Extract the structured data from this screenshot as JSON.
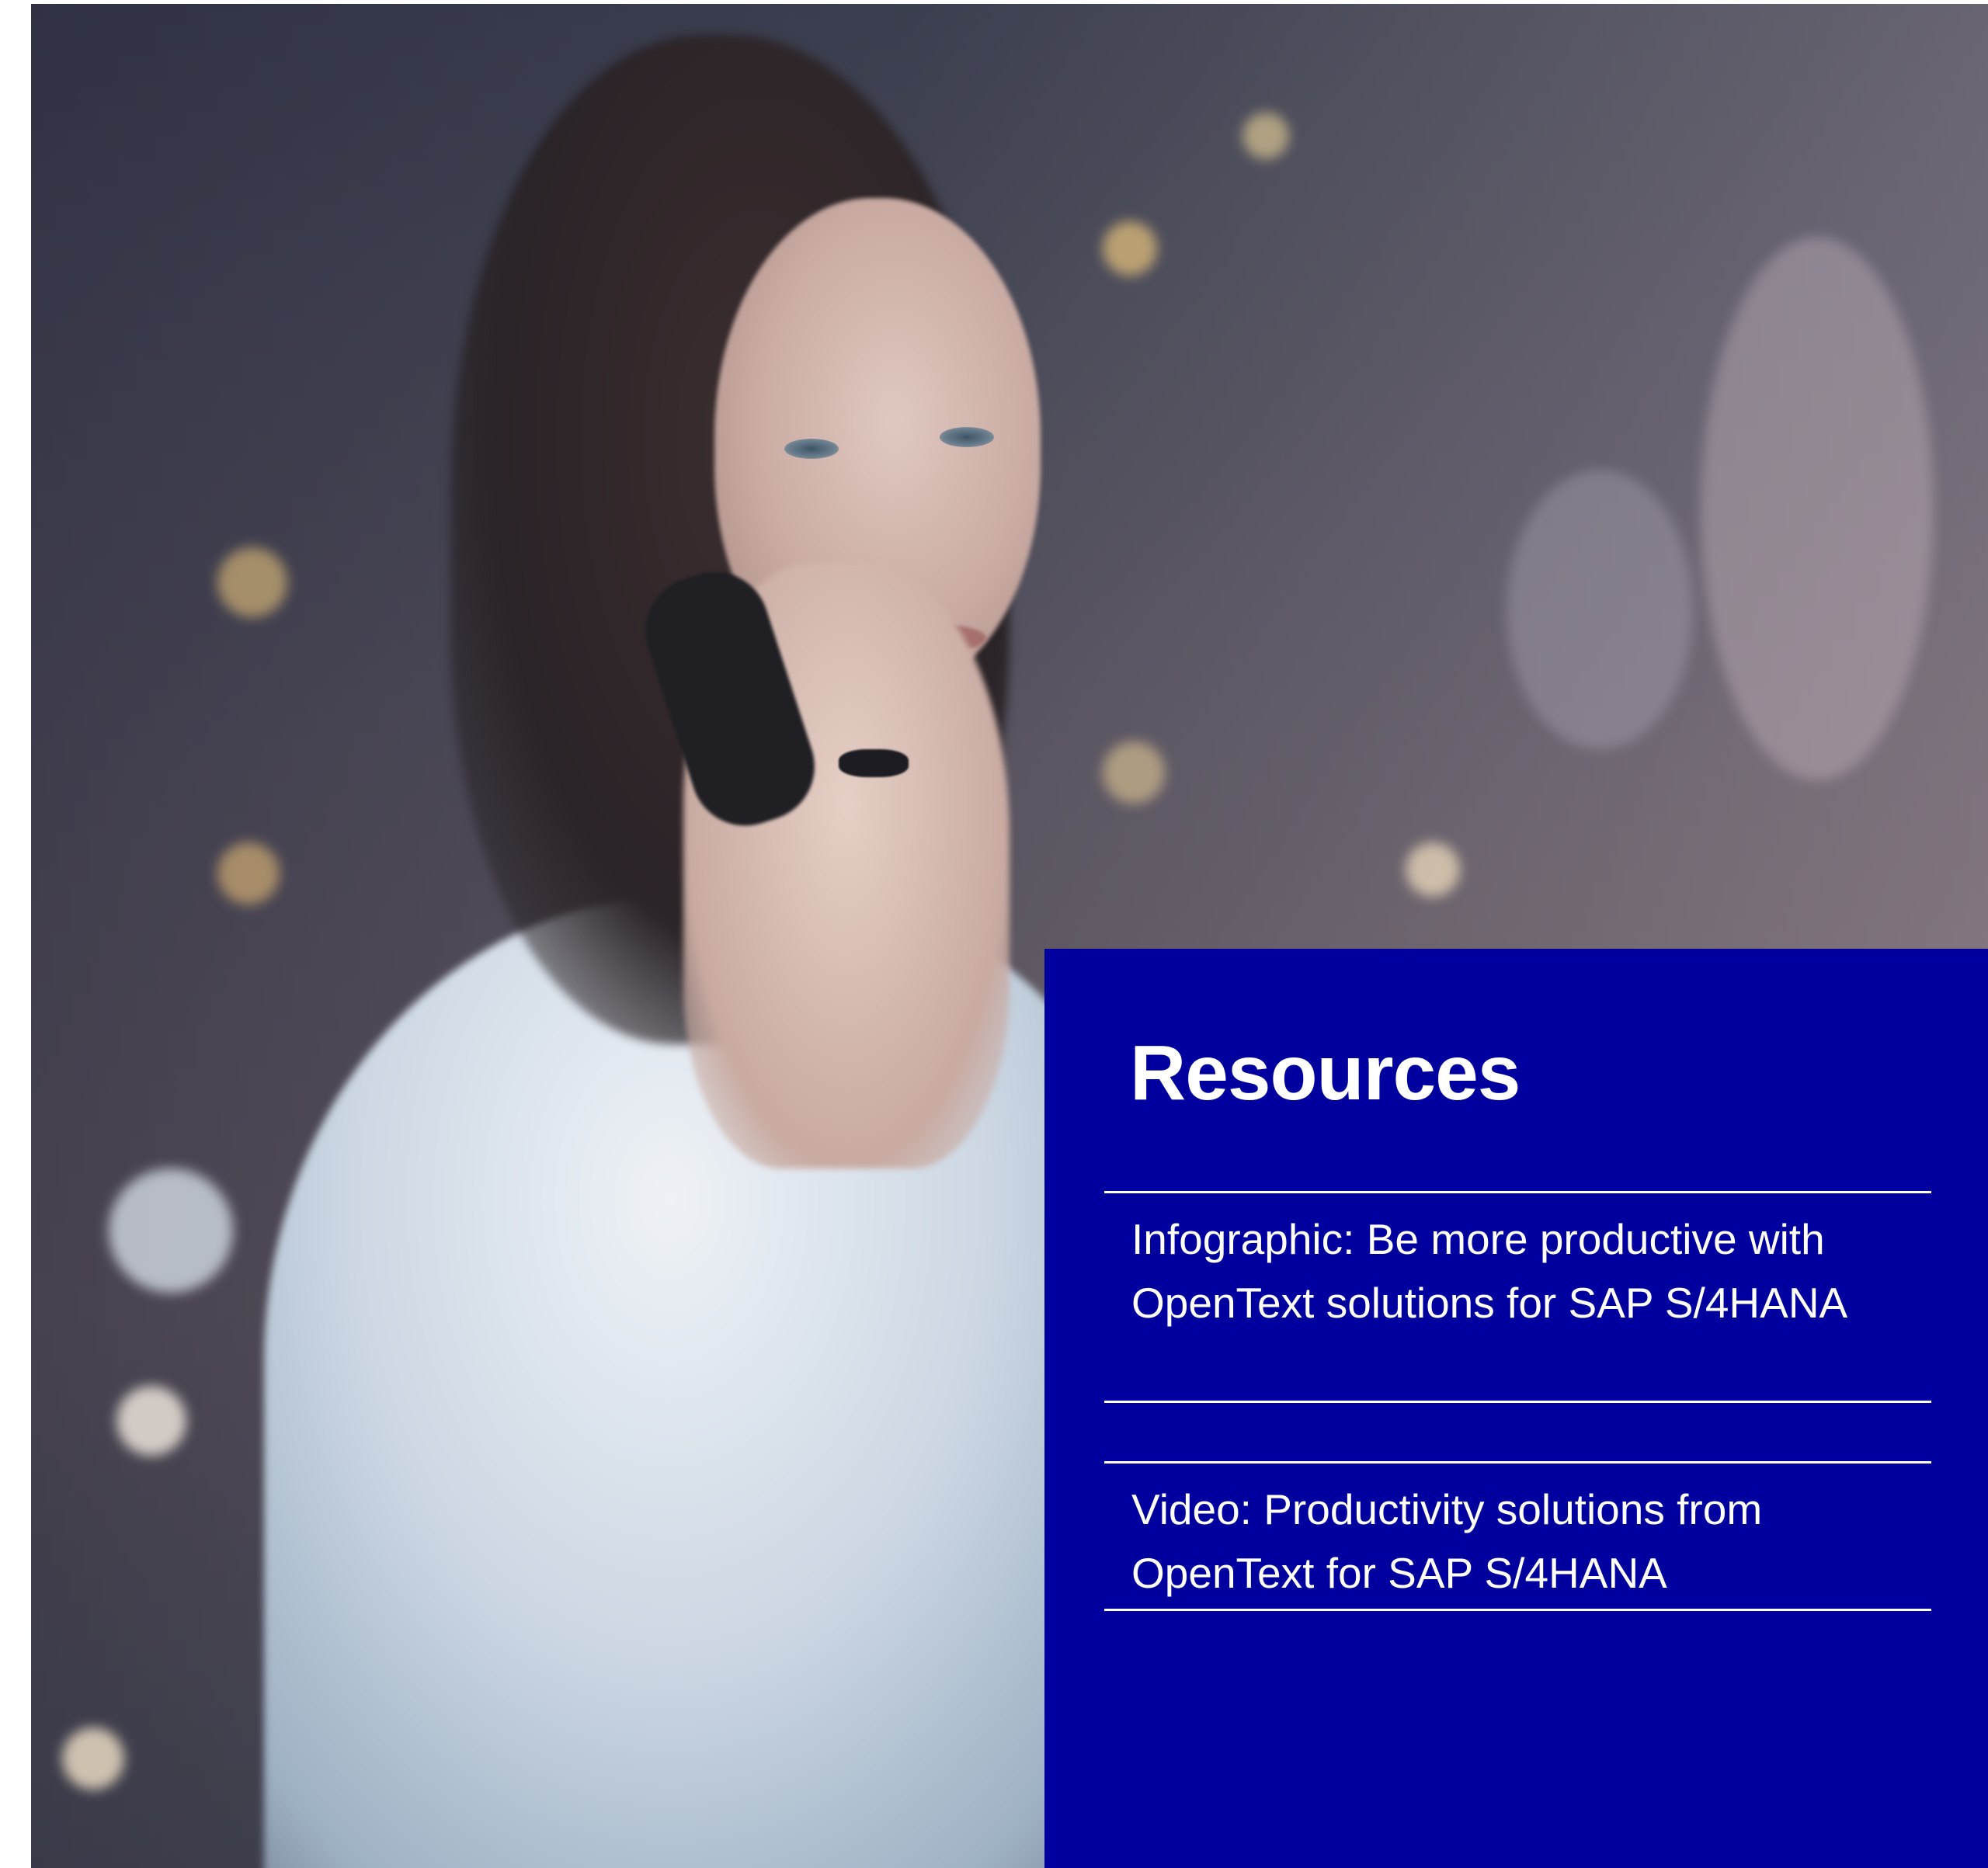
{
  "hero": {
    "image": "woman-on-phone-photo"
  },
  "resources": {
    "title": "Resources",
    "items": [
      {
        "label": "Infographic: Be more productive with OpenText solutions for SAP S/4HANA"
      },
      {
        "label": "Video: Productivity solutions from OpenText for SAP S/4HANA"
      }
    ]
  },
  "colors": {
    "panel_background": "#00009f",
    "text": "#ffffff",
    "divider": "#ffffff"
  }
}
